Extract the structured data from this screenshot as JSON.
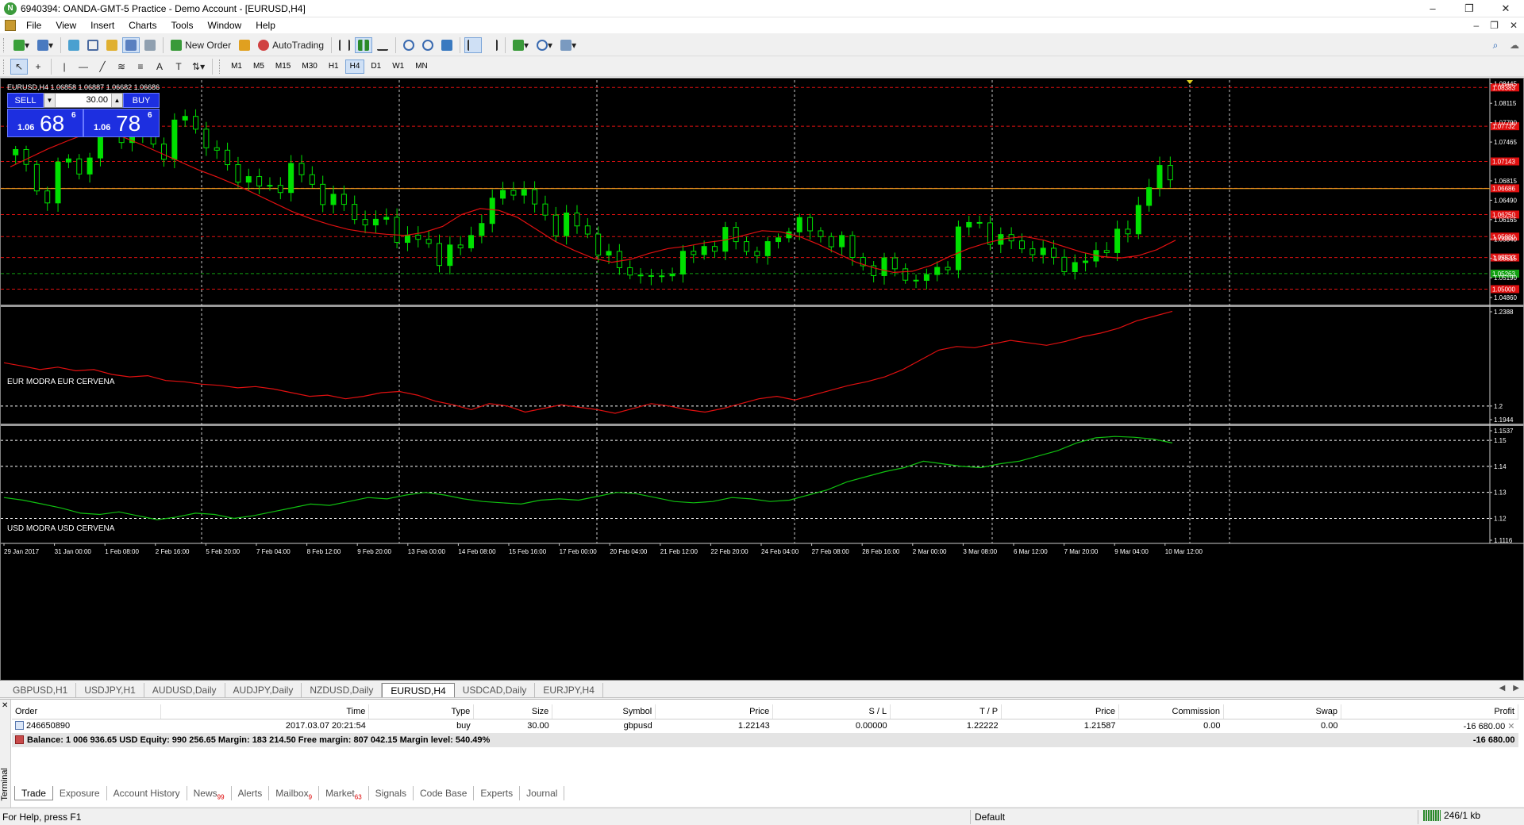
{
  "window": {
    "title": "6940394: OANDA-GMT-5 Practice - Demo Account - [EURUSD,H4]",
    "controls": [
      "–",
      "❐",
      "✕"
    ]
  },
  "menu": {
    "items": [
      "File",
      "View",
      "Insert",
      "Charts",
      "Tools",
      "Window",
      "Help"
    ],
    "right": [
      "–",
      "❐",
      "✕"
    ]
  },
  "toolbar": {
    "new_order": "New Order",
    "autotrading": "AutoTrading",
    "timeframes": [
      "M1",
      "M5",
      "M15",
      "M30",
      "H1",
      "H4",
      "D1",
      "W1",
      "MN"
    ],
    "active_timeframe": "H4"
  },
  "chart": {
    "symbol_info": "EURUSD,H4  1.06858 1.06887 1.06682 1.06686",
    "trade_panel": {
      "sell_label": "SELL",
      "buy_label": "BUY",
      "lot": "30.00",
      "sell_prefix": "1.06",
      "sell_big": "68",
      "sell_sup": "6",
      "buy_prefix": "1.06",
      "buy_big": "78",
      "buy_sup": "6"
    },
    "pane2_label": "EUR MODRA   EUR CERVENA",
    "pane3_label": "USD MODRA   USD CERVENA",
    "colors": {
      "bull": "#00e000",
      "bear": "#00e000",
      "ma": "#e01010",
      "eur_line": "#e01010",
      "usd_line": "#10c010",
      "price_line": "#e8a020",
      "grid": "#c8c8c8"
    }
  },
  "chart_data": [
    {
      "type": "candlestick",
      "title": "EURUSD,H4",
      "y_axis_ticks": [
        "1.08445",
        "1.08115",
        "1.07790",
        "1.07465",
        "1.06815",
        "1.06490",
        "1.06165",
        "1.05840",
        "1.05515",
        "1.05190",
        "1.04860"
      ],
      "ylim": [
        1.0486,
        1.0845
      ],
      "current_price": "1.06686",
      "level_labels": [
        {
          "value": 1.0838,
          "label": "1.08383",
          "color": "#e01010"
        },
        {
          "value": 1.0773,
          "label": "1.07732",
          "color": "#e01010"
        },
        {
          "value": 1.0714,
          "label": "1.07143",
          "color": "#e01010"
        },
        {
          "value": 1.0669,
          "label": "1.06686",
          "color": "#e01010"
        },
        {
          "value": 1.0625,
          "label": "1.06250",
          "color": "#e01010"
        },
        {
          "value": 1.0588,
          "label": "1.05880",
          "color": "#e01010"
        },
        {
          "value": 1.0553,
          "label": "1.05533",
          "color": "#e01010"
        },
        {
          "value": 1.0526,
          "label": "1.05263",
          "color": "#10a010"
        },
        {
          "value": 1.05,
          "label": "1.05000",
          "color": "#e01010"
        }
      ],
      "close_path": [
        1.0725,
        1.0705,
        1.063,
        1.07,
        1.0715,
        1.0695,
        1.074,
        1.079,
        1.076,
        1.0775,
        1.075,
        1.072,
        1.077,
        1.079,
        1.076,
        1.0735,
        1.0705,
        1.069,
        1.0685,
        1.066,
        1.0675,
        1.07,
        1.069,
        1.066,
        1.065,
        1.064,
        1.062,
        1.0605,
        1.062,
        1.0595,
        1.058,
        1.0585,
        1.0555,
        1.056,
        1.057,
        1.06,
        1.0635,
        1.066,
        1.067,
        1.066,
        1.0625,
        1.0605,
        1.0615,
        1.0605,
        1.058,
        1.0555,
        1.0535,
        1.053,
        1.052,
        1.051,
        1.054,
        1.0555,
        1.056,
        1.0575,
        1.059,
        1.058,
        1.056,
        1.0565,
        1.058,
        1.061,
        1.0615,
        1.058,
        1.059,
        1.0575,
        1.055,
        1.053,
        1.054,
        1.0535,
        1.052,
        1.051,
        1.053,
        1.0545,
        1.06,
        1.062,
        1.0595,
        1.0575,
        1.0585,
        1.0565,
        1.056,
        1.0555,
        1.054,
        1.0535,
        1.0555,
        1.0575,
        1.0585,
        1.06,
        1.067,
        1.0695,
        1.0686
      ],
      "ma_path": [
        1.0705,
        1.072,
        1.0735,
        1.0748,
        1.076,
        1.0762,
        1.0755,
        1.0742,
        1.0728,
        1.0714,
        1.07,
        1.0688,
        1.0675,
        1.066,
        1.0645,
        1.063,
        1.0618,
        1.0608,
        1.06,
        1.0595,
        1.0592,
        1.059,
        1.0595,
        1.0605,
        1.0625,
        1.0635,
        1.0632,
        1.062,
        1.06,
        1.058,
        1.0565,
        1.0552,
        1.0545,
        1.055,
        1.056,
        1.0568,
        1.0572,
        1.0578,
        1.0582,
        1.059,
        1.0598,
        1.0596,
        1.0588,
        1.0575,
        1.056,
        1.0545,
        1.0535,
        1.0528,
        1.053,
        1.054,
        1.0555,
        1.0568,
        1.0578,
        1.0585,
        1.0588,
        1.0582,
        1.0572,
        1.0562,
        1.0555,
        1.0552,
        1.0556,
        1.0566,
        1.0582
      ]
    },
    {
      "type": "line",
      "series": [
        {
          "name": "EUR CERVENA",
          "color": "#e01010"
        }
      ],
      "y_axis_ticks": [
        "1.2388",
        "1.2",
        "1.1944"
      ],
      "ylim": [
        1.1944,
        1.2388
      ],
      "values": [
        1.2178,
        1.2165,
        1.215,
        1.216,
        1.2145,
        1.215,
        1.213,
        1.212,
        1.2125,
        1.2105,
        1.21,
        1.209,
        1.2085,
        1.2075,
        1.208,
        1.207,
        1.2055,
        1.204,
        1.2045,
        1.203,
        1.204,
        1.2055,
        1.206,
        1.2045,
        1.202,
        1.2005,
        1.1985,
        1.201,
        1.2,
        1.1975,
        1.199,
        1.2005,
        1.1995,
        1.1985,
        1.197,
        1.199,
        1.201,
        1.2,
        1.1985,
        1.1975,
        1.199,
        1.201,
        1.203,
        1.204,
        1.2025,
        1.2045,
        1.2065,
        1.2085,
        1.21,
        1.212,
        1.215,
        1.219,
        1.223,
        1.2245,
        1.224,
        1.2255,
        1.227,
        1.226,
        1.225,
        1.2265,
        1.2285,
        1.23,
        1.232,
        1.235,
        1.237,
        1.239
      ]
    },
    {
      "type": "line",
      "series": [
        {
          "name": "USD CERVENA",
          "color": "#10c010"
        }
      ],
      "y_axis_ticks": [
        "1.1537",
        "1.15",
        "1.14",
        "1.13",
        "1.12",
        "1.1116"
      ],
      "ylim": [
        1.1116,
        1.1537
      ],
      "values": [
        1.128,
        1.127,
        1.1255,
        1.124,
        1.122,
        1.1215,
        1.1225,
        1.121,
        1.1195,
        1.1205,
        1.122,
        1.1215,
        1.12,
        1.121,
        1.1225,
        1.124,
        1.1255,
        1.125,
        1.1265,
        1.128,
        1.1275,
        1.129,
        1.13,
        1.129,
        1.1275,
        1.1265,
        1.126,
        1.1255,
        1.127,
        1.1275,
        1.127,
        1.1285,
        1.13,
        1.1295,
        1.128,
        1.1265,
        1.126,
        1.1265,
        1.128,
        1.1275,
        1.1265,
        1.127,
        1.129,
        1.131,
        1.134,
        1.136,
        1.138,
        1.1395,
        1.142,
        1.141,
        1.14,
        1.1395,
        1.141,
        1.142,
        1.144,
        1.146,
        1.149,
        1.151,
        1.1515,
        1.1512,
        1.1505,
        1.149
      ]
    }
  ],
  "time_axis": [
    "29 Jan 2017",
    "31 Jan 00:00",
    "1 Feb 08:00",
    "2 Feb 16:00",
    "5 Feb 20:00",
    "7 Feb 04:00",
    "8 Feb 12:00",
    "9 Feb 20:00",
    "13 Feb 00:00",
    "14 Feb 08:00",
    "15 Feb 16:00",
    "17 Feb 00:00",
    "20 Feb 04:00",
    "21 Feb 12:00",
    "22 Feb 20:00",
    "24 Feb 04:00",
    "27 Feb 08:00",
    "28 Feb 16:00",
    "2 Mar 00:00",
    "3 Mar 08:00",
    "6 Mar 12:00",
    "7 Mar 20:00",
    "9 Mar 04:00",
    "10 Mar 12:00"
  ],
  "chart_tabs": {
    "items": [
      "GBPUSD,H1",
      "USDJPY,H1",
      "AUDUSD,Daily",
      "AUDJPY,Daily",
      "NZDUSD,Daily",
      "EURUSD,H4",
      "USDCAD,Daily",
      "EURJPY,H4"
    ],
    "active": "EURUSD,H4"
  },
  "terminal": {
    "side_label": "Terminal",
    "columns": [
      "Order",
      "Time",
      "Type",
      "Size",
      "Symbol",
      "Price",
      "S / L",
      "T / P",
      "Price",
      "Commission",
      "Swap",
      "Profit"
    ],
    "rows": [
      [
        "246650890",
        "2017.03.07 20:21:54",
        "buy",
        "30.00",
        "gbpusd",
        "1.22143",
        "0.00000",
        "1.22222",
        "1.21587",
        "0.00",
        "0.00",
        "-16 680.00"
      ]
    ],
    "summary": "Balance: 1 006 936.65 USD  Equity: 990 256.65  Margin: 183 214.50  Free margin: 807 042.15  Margin level: 540.49%",
    "summary_profit": "-16 680.00",
    "tabs": [
      {
        "label": "Trade",
        "badge": ""
      },
      {
        "label": "Exposure",
        "badge": ""
      },
      {
        "label": "Account History",
        "badge": ""
      },
      {
        "label": "News",
        "badge": "99"
      },
      {
        "label": "Alerts",
        "badge": ""
      },
      {
        "label": "Mailbox",
        "badge": "9"
      },
      {
        "label": "Market",
        "badge": "63"
      },
      {
        "label": "Signals",
        "badge": ""
      },
      {
        "label": "Code Base",
        "badge": ""
      },
      {
        "label": "Experts",
        "badge": ""
      },
      {
        "label": "Journal",
        "badge": ""
      }
    ],
    "active_tab": "Trade"
  },
  "statusbar": {
    "help": "For Help, press F1",
    "profile": "Default",
    "traffic": "246/1 kb"
  }
}
